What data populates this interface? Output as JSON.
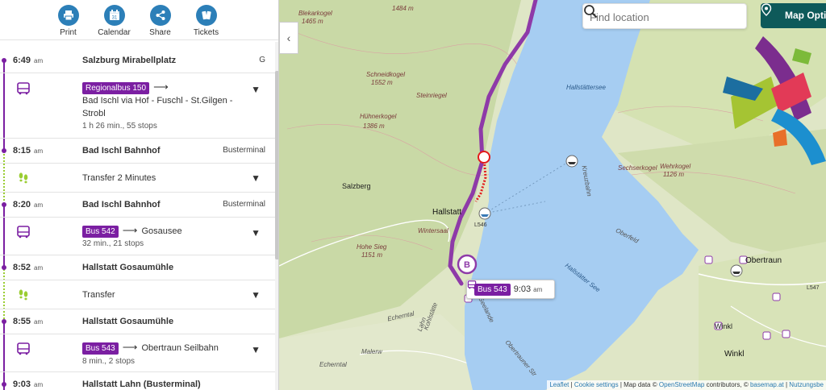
{
  "toolbar": {
    "items": [
      {
        "label": "Print",
        "icon": "printer-icon"
      },
      {
        "label": "Calendar",
        "icon": "calendar-icon"
      },
      {
        "label": "Share",
        "icon": "share-icon"
      },
      {
        "label": "Tickets",
        "icon": "tickets-icon"
      }
    ]
  },
  "itinerary": {
    "stops": [
      {
        "time": "6:49",
        "ampm": "am",
        "name": "Salzburg Mirabellplatz",
        "platform": "G"
      },
      {
        "time": "8:15",
        "ampm": "am",
        "name": "Bad Ischl Bahnhof",
        "platform": "Busterminal"
      },
      {
        "time": "8:20",
        "ampm": "am",
        "name": "Bad Ischl Bahnhof",
        "platform": "Busterminal"
      },
      {
        "time": "8:52",
        "ampm": "am",
        "name": "Hallstatt Gosaumühle",
        "platform": ""
      },
      {
        "time": "8:55",
        "ampm": "am",
        "name": "Hallstatt Gosaumühle",
        "platform": ""
      },
      {
        "time": "9:03",
        "ampm": "am",
        "name": "Hallstatt Lahn (Busterminal)",
        "platform": ""
      }
    ],
    "legs": [
      {
        "type": "bus",
        "line": "Regionalbus 150",
        "arrow": "⟶",
        "direction": "Bad Ischl via Hof - Fuschl - St.Gilgen - Strobl",
        "details": "1 h 26 min., 55 stops"
      },
      {
        "type": "walk",
        "label": "Transfer 2 Minutes"
      },
      {
        "type": "bus",
        "line": "Bus 542",
        "arrow": "⟶",
        "direction": "Gosausee",
        "details": "32 min., 21 stops"
      },
      {
        "type": "walk",
        "label": "Transfer"
      },
      {
        "type": "bus",
        "line": "Bus 543",
        "arrow": "⟶",
        "direction": "Obertraun Seilbahn",
        "details": "8 min., 2 stops"
      }
    ],
    "chevron": "▼"
  },
  "map": {
    "search_placeholder": "Find location",
    "options_label": "Map Options",
    "collapse": "‹",
    "marker_b": "B",
    "popup": {
      "line": "Bus 543",
      "time": "9:03",
      "ampm": "am"
    },
    "labels": {
      "lake": "Hallstättersee",
      "lake2": "Hallstätter See",
      "town": "Hallstatt",
      "salzberg": "Salzberg",
      "obertraun": "Obertraun",
      "winkl": "Winkl",
      "winkl2": "Winkl",
      "blekar": "Blekarkogel",
      "blekar_h": "1465 m",
      "schneid": "Schneidkogel",
      "schneid_h": "1552 m",
      "huehner": "Hühnerkogel",
      "huehner_h": "1386 m",
      "steinrieg": "Steinriegel",
      "hohesieg": "Hohe Sieg",
      "hohesieg_h": "1151 m",
      "sechser": "Sechserkogel",
      "wehrkogel": "Wehrkogel",
      "wehr_h": "1126 m",
      "wintersaal": "Wintersaal",
      "oberfeld": "Oberfeld",
      "kreuzbahn": "Kreuzbahn",
      "echerntal": "Echerntal",
      "echerntal2": "Echerntal",
      "malerw": "Malerw",
      "seelande": "Seelande",
      "lahn": "Lahn",
      "kohlstatte": "Kohlstätte",
      "traunstr": "Obertrauner Str",
      "l546": "L546",
      "l547": "L547",
      "h1484": "1484 m",
      "h1126": "1126 m"
    },
    "attribution": {
      "leaflet": "Leaflet",
      "cookies": "Cookie settings",
      "data_prefix": "Map data ©",
      "osm": "OpenStreetMap",
      "mid": "contributors, ©",
      "basemap": "basemap.at",
      "nutz": "Nutzungsbe"
    },
    "colors": {
      "route": "#8e3aa8",
      "walk": "#e31a1c",
      "lake": "#a6cdf2",
      "forest": "#c8d9a8",
      "brand": "#0e5a5a"
    }
  }
}
